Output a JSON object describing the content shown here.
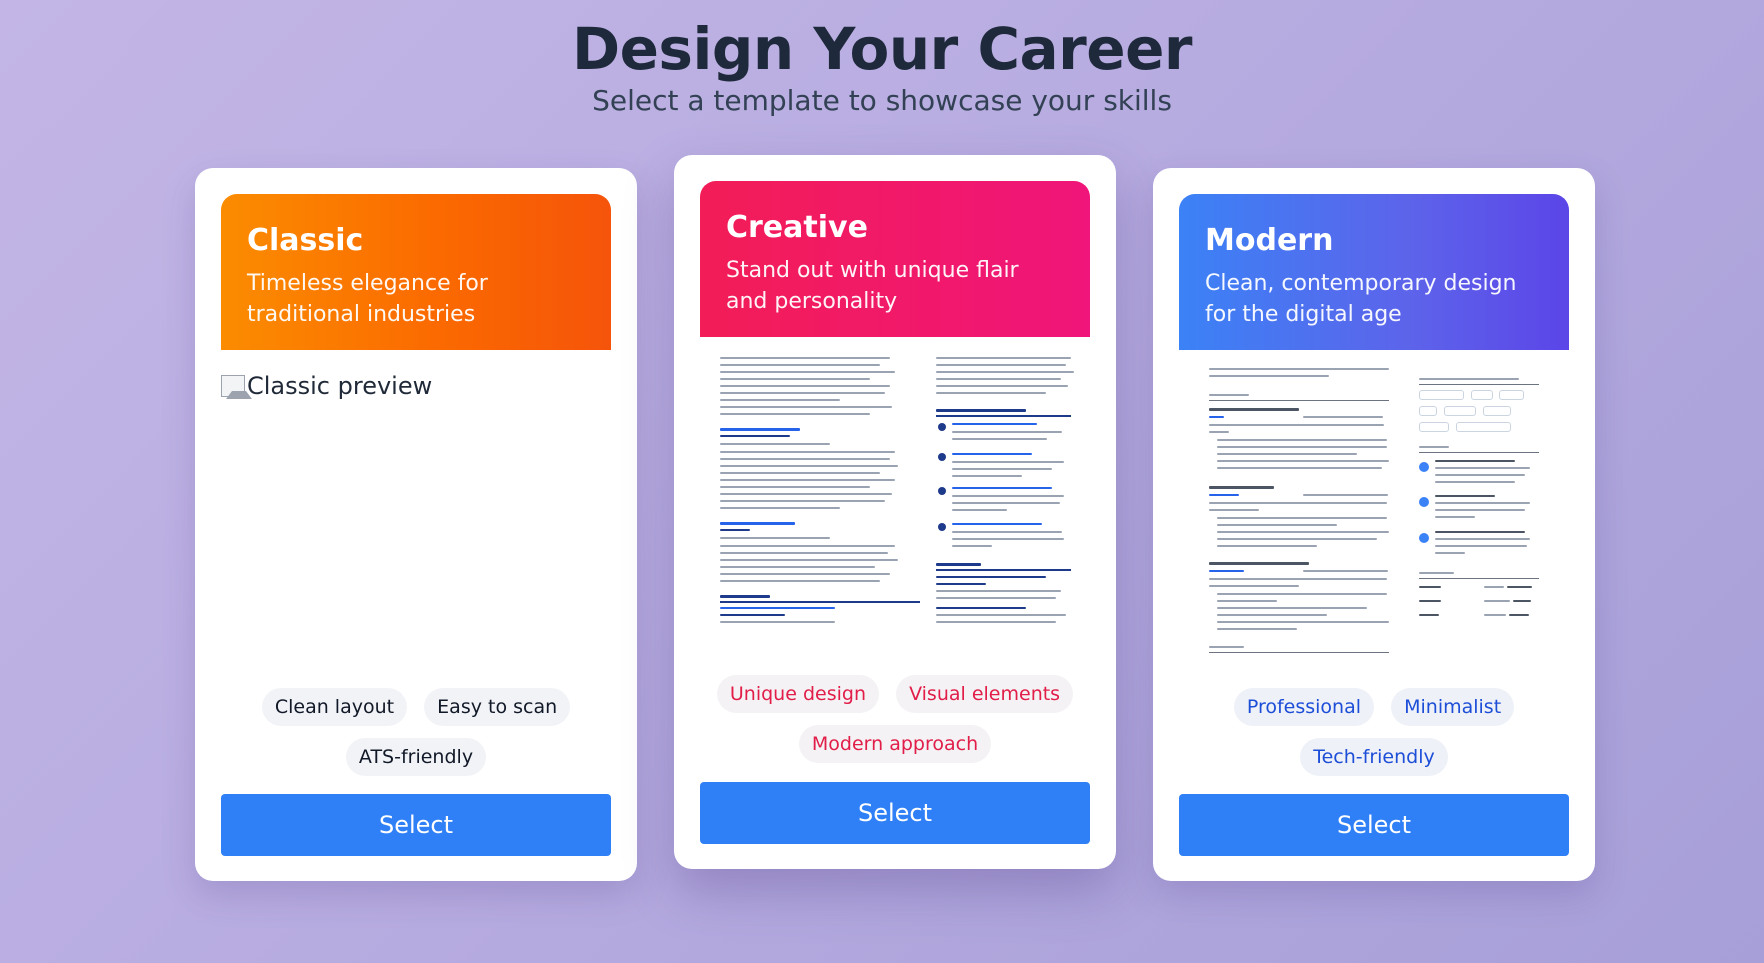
{
  "header": {
    "title": "Design Your Career",
    "subtitle": "Select a template to showcase your skills"
  },
  "templates": [
    {
      "name": "Classic",
      "description": "Timeless elegance for traditional industries",
      "preview_alt": "Classic preview",
      "tags": [
        "Clean layout",
        "Easy to scan",
        "ATS-friendly"
      ],
      "button": "Select",
      "color": "#fb6a00"
    },
    {
      "name": "Creative",
      "description": "Stand out with unique flair and personality",
      "tags": [
        "Unique design",
        "Visual elements",
        "Modern approach"
      ],
      "button": "Select",
      "color": "#f21d67"
    },
    {
      "name": "Modern",
      "description": "Clean, contemporary design for the digital age",
      "tags": [
        "Professional",
        "Minimalist",
        "Tech-friendly"
      ],
      "button": "Select",
      "color": "#4f5ef0"
    }
  ],
  "colors": {
    "button": "#2f80f6",
    "title": "#1e293b"
  }
}
